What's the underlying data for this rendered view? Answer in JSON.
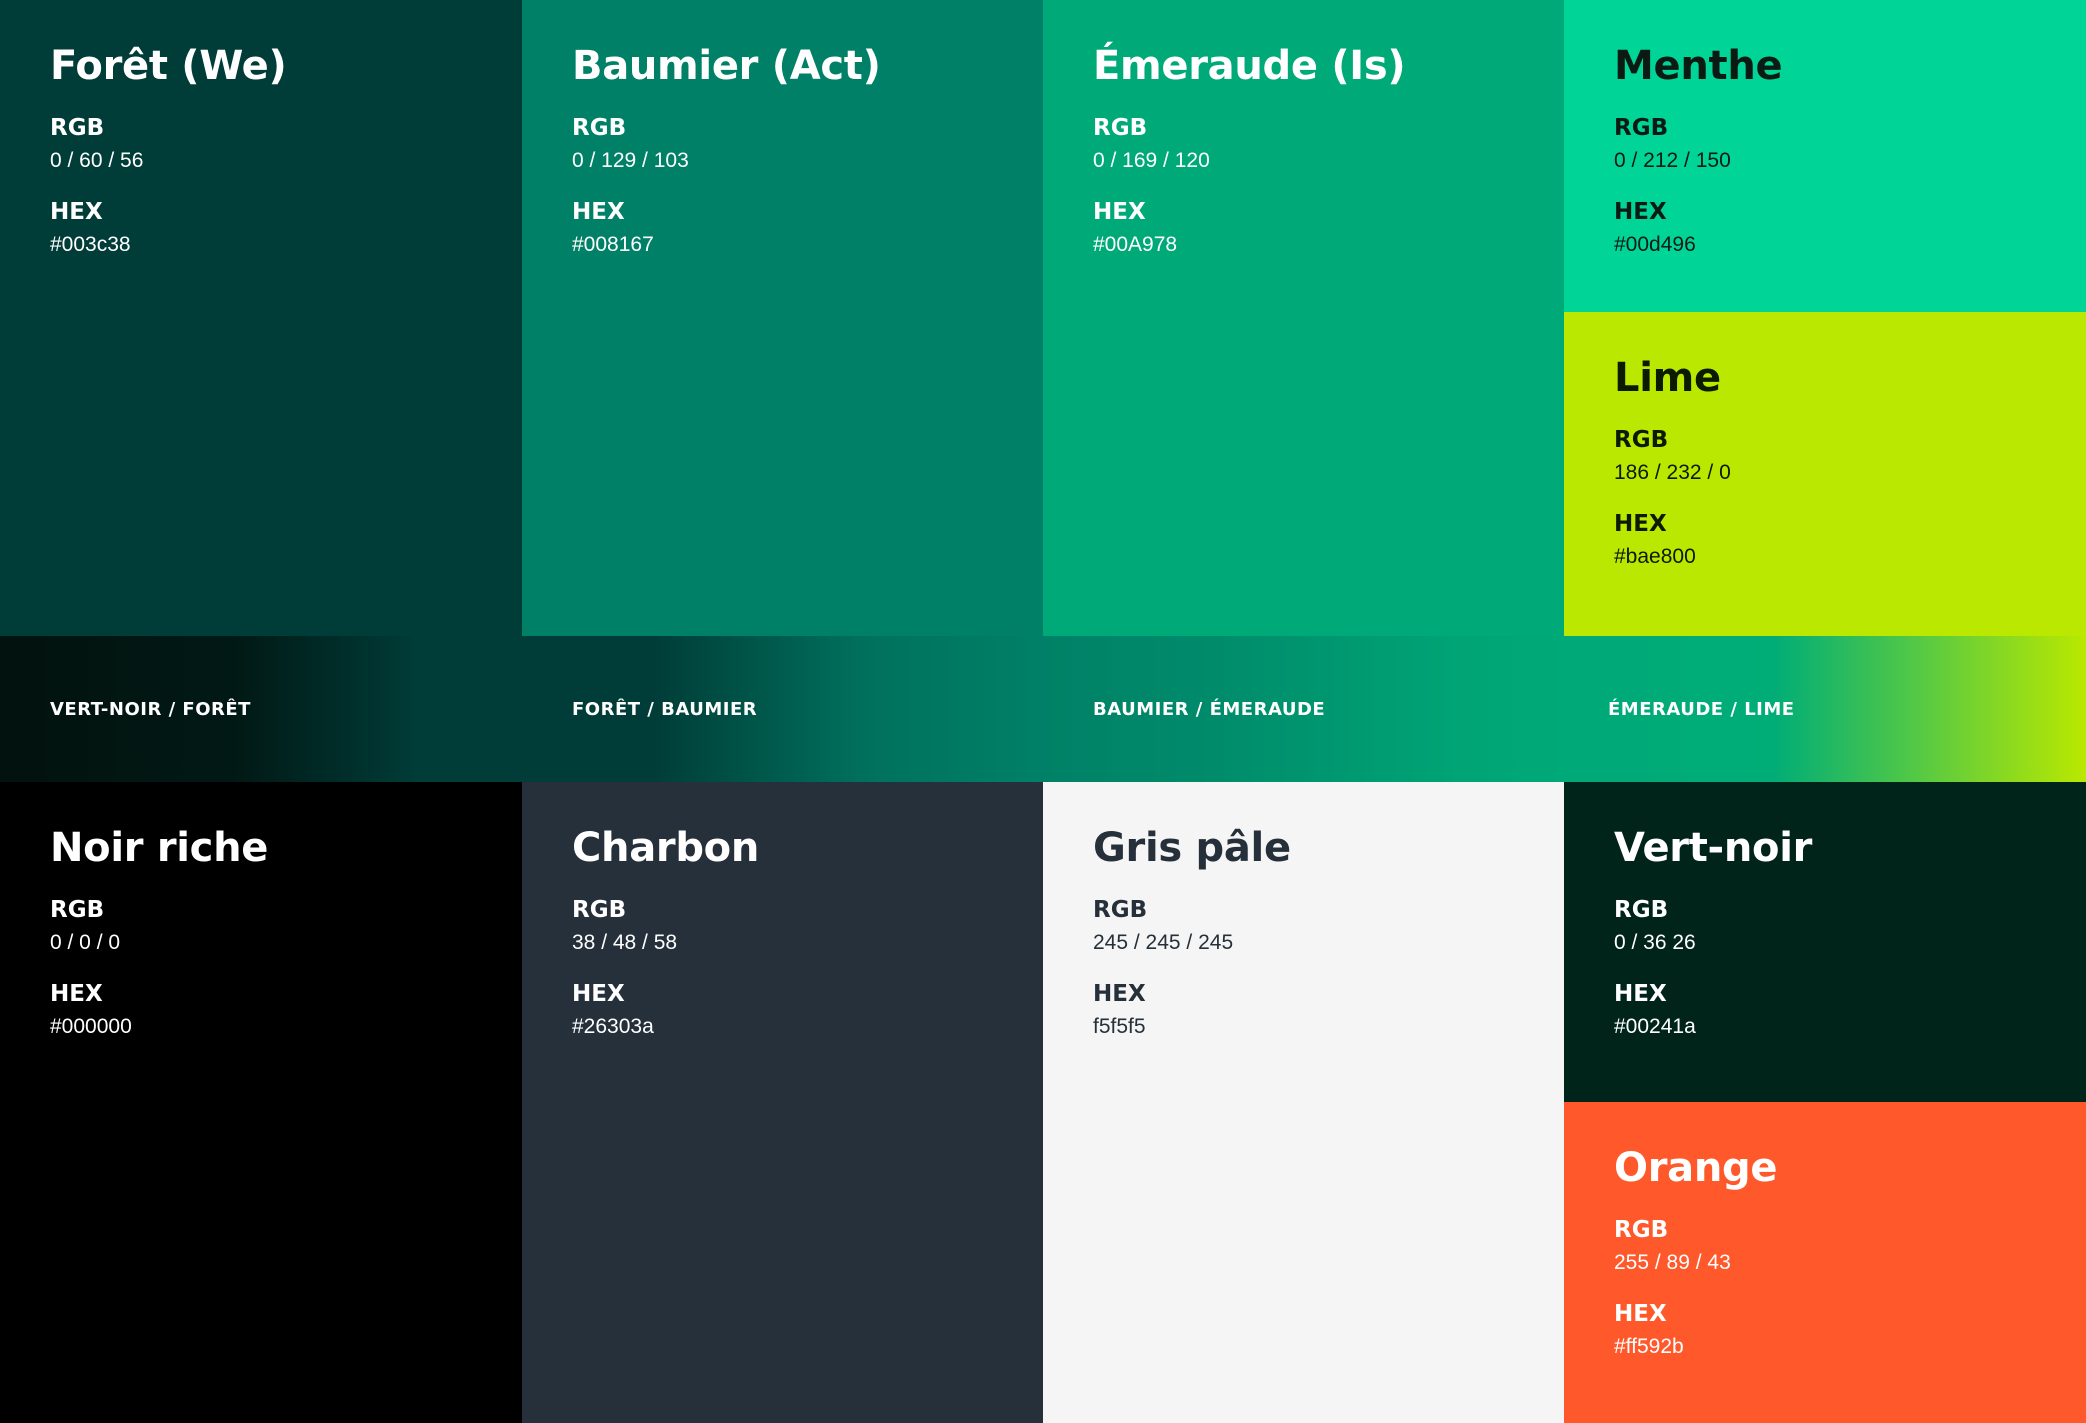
{
  "labels": {
    "rgb": "RGB",
    "hex": "HEX"
  },
  "colors": {
    "foret": {
      "name": "Forêt (We)",
      "rgb": "0 / 60 / 56",
      "hex": "#003c38",
      "swatch": "#003c38"
    },
    "baumier": {
      "name": "Baumier (Act)",
      "rgb": "0 / 129 / 103",
      "hex": "#008167",
      "swatch": "#008167"
    },
    "emeraude": {
      "name": "Émeraude (Is)",
      "rgb": "0 / 169 / 120",
      "hex": "#00A978",
      "swatch": "#00a978"
    },
    "menthe": {
      "name": "Menthe",
      "rgb": "0 / 212 / 150",
      "hex": "#00d496",
      "swatch": "#00d496"
    },
    "lime": {
      "name": "Lime",
      "rgb": "186 / 232 / 0",
      "hex": "#bae800",
      "swatch": "#bae800"
    },
    "noir_riche": {
      "name": "Noir riche",
      "rgb": "0 / 0 / 0",
      "hex": "#000000",
      "swatch": "#000000"
    },
    "charbon": {
      "name": "Charbon",
      "rgb": "38 / 48 / 58",
      "hex": "#26303a",
      "swatch": "#26303a"
    },
    "gris_pale": {
      "name": "Gris pâle",
      "rgb": "245 / 245 / 245",
      "hex": "f5f5f5",
      "swatch": "#f5f5f5"
    },
    "vert_noir": {
      "name": "Vert-noir",
      "rgb": "0 / 36 26",
      "hex": "#00241a",
      "swatch": "#00241a"
    },
    "orange": {
      "name": "Orange",
      "rgb": "255 / 89 / 43",
      "hex": "#ff592b",
      "swatch": "#ff592b"
    }
  },
  "gradients": [
    {
      "label": "VERT-NOIR / FORÊT",
      "from": "#00241a",
      "to": "#003c38"
    },
    {
      "label": "FORÊT / BAUMIER",
      "from": "#003c38",
      "to": "#008167"
    },
    {
      "label": "BAUMIER / ÉMERAUDE",
      "from": "#008167",
      "to": "#00a978"
    },
    {
      "label": "ÉMERAUDE / LIME",
      "from": "#00a978",
      "to": "#bae800"
    }
  ]
}
